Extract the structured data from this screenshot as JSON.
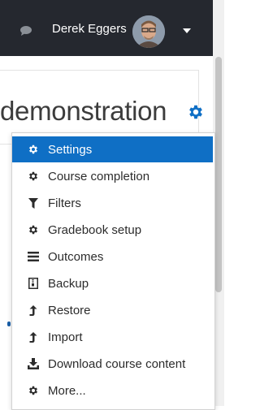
{
  "navbar": {
    "user_name": "Derek Eggers",
    "icons": [
      "chat-icon",
      "avatar",
      "caret-down-icon"
    ]
  },
  "course": {
    "title_fragment": "demonstration",
    "settings_icon": "gear-icon"
  },
  "menu": {
    "items": [
      {
        "label": "Settings",
        "icon": "gear-icon",
        "active": true
      },
      {
        "label": "Course completion",
        "icon": "gear-icon",
        "active": false
      },
      {
        "label": "Filters",
        "icon": "filter-icon",
        "active": false
      },
      {
        "label": "Gradebook setup",
        "icon": "gear-icon",
        "active": false
      },
      {
        "label": "Outcomes",
        "icon": "list-icon",
        "active": false
      },
      {
        "label": "Backup",
        "icon": "file-archive-icon",
        "active": false
      },
      {
        "label": "Restore",
        "icon": "level-up-icon",
        "active": false
      },
      {
        "label": "Import",
        "icon": "level-up-icon",
        "active": false
      },
      {
        "label": "Download course content",
        "icon": "download-icon",
        "active": false
      },
      {
        "label": "More...",
        "icon": "gear-icon",
        "active": false
      }
    ]
  },
  "colors": {
    "navbar_bg": "#25282f",
    "active_item_bg": "#0f6fc5",
    "settings_gear": "#0f6fc5"
  }
}
